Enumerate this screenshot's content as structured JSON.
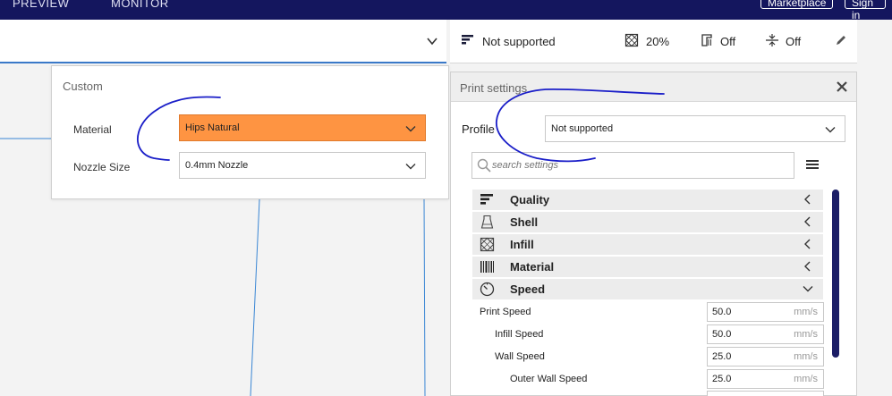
{
  "topbar": {
    "nav_preview": "PREVIEW",
    "nav_monitor": "MONITOR",
    "marketplace": "Marketplace",
    "signin": "Sign in"
  },
  "custom_popup": {
    "title": "Custom",
    "material_label": "Material",
    "material_value": "Hips Natural",
    "nozzle_label": "Nozzle Size",
    "nozzle_value": "0.4mm Nozzle"
  },
  "status": {
    "profile": "Not supported",
    "infill": "20%",
    "support": "Off",
    "adhesion": "Off"
  },
  "print_settings": {
    "title": "Print settings",
    "profile_label": "Profile",
    "profile_value": "Not supported",
    "search_placeholder": "search settings",
    "categories": [
      {
        "label": "Quality",
        "icon": "quality-icon",
        "expanded": false
      },
      {
        "label": "Shell",
        "icon": "shell-icon",
        "expanded": false
      },
      {
        "label": "Infill",
        "icon": "infill-icon",
        "expanded": false
      },
      {
        "label": "Material",
        "icon": "material-icon",
        "expanded": false
      },
      {
        "label": "Speed",
        "icon": "speed-icon",
        "expanded": true
      }
    ],
    "speed_settings": [
      {
        "label": "Print Speed",
        "value": "50.0",
        "unit": "mm/s",
        "indent": 0
      },
      {
        "label": "Infill Speed",
        "value": "50.0",
        "unit": "mm/s",
        "indent": 1
      },
      {
        "label": "Wall Speed",
        "value": "25.0",
        "unit": "mm/s",
        "indent": 1
      },
      {
        "label": "Outer Wall Speed",
        "value": "25.0",
        "unit": "mm/s",
        "indent": 2
      }
    ]
  },
  "colors": {
    "nav_bg": "#14165e",
    "material_highlight": "#fe9442",
    "accent_blue": "#3a79c8",
    "annotation_ink": "#1a1ec8"
  }
}
